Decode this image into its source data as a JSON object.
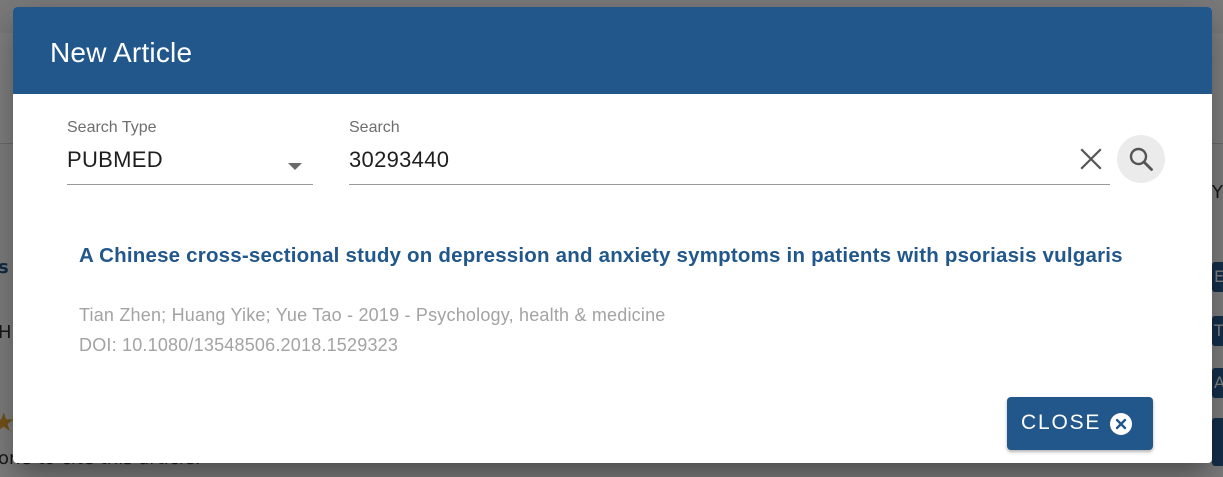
{
  "background": {
    "left_text_1": "s",
    "left_text_2": "H",
    "left_text_3": "one to cite this article:",
    "right_text_1": "Y",
    "right_buttons": [
      "E",
      "T",
      "A"
    ]
  },
  "dialog": {
    "title": "New Article",
    "search_type": {
      "label": "Search Type",
      "value": "PUBMED"
    },
    "search": {
      "label": "Search",
      "value": "30293440"
    },
    "result": {
      "title": "A Chinese cross-sectional study on depression and anxiety symptoms in patients with psoriasis vulgaris",
      "authors_line": "Tian Zhen; Huang Yike; Yue Tao - 2019 - Psychology, health & medicine",
      "doi_line": "DOI: 10.1080/13548506.2018.1529323"
    },
    "close_label": "CLOSE"
  },
  "colors": {
    "primary": "#22578c",
    "muted_text": "#a3a3a3"
  },
  "icons": [
    "dropdown-arrow-icon",
    "clear-icon",
    "search-icon",
    "close-circle-icon"
  ]
}
